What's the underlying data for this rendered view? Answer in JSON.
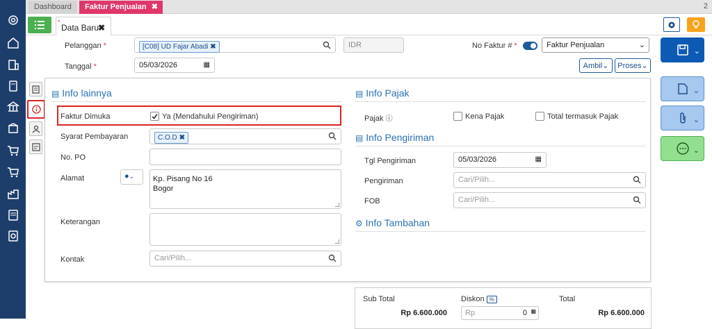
{
  "tabs": {
    "dashboard": "Dashboard",
    "faktur": "Faktur Penjualan",
    "count": "2"
  },
  "toolbar": {
    "data_tab": "Data Baru"
  },
  "header": {
    "pelanggan_label": "Pelanggan",
    "pelanggan_chip": "[C08] UD Fajar Abadi",
    "currency": "IDR",
    "no_faktur_label": "No Faktur #",
    "no_faktur_select": "Faktur Penjualan",
    "tanggal_label": "Tanggal",
    "tanggal_value": "05/03/2026",
    "ambil_label": "Ambil",
    "proses_label": "Proses"
  },
  "info_lainnya": {
    "title": "Info lainnya",
    "faktur_dimuka_label": "Faktur Dimuka",
    "faktur_dimuka_option": "Ya (Mendahului Pengiriman)",
    "syarat_label": "Syarat Pembayaran",
    "syarat_chip": "C.O.D",
    "po_label": "No. PO",
    "alamat_label": "Alamat",
    "alamat_line1": "Kp. Pisang No 16",
    "alamat_line2": "Bogor",
    "keterangan_label": "Keterangan",
    "kontak_label": "Kontak",
    "kontak_placeholder": "Cari/Pilih..."
  },
  "info_pajak": {
    "title": "Info Pajak",
    "pajak_label": "Pajak",
    "kena_pajak": "Kena Pajak",
    "total_pajak": "Total termasuk Pajak"
  },
  "info_pengiriman": {
    "title": "Info Pengiriman",
    "tgl_label": "Tgl Pengiriman",
    "tgl_value": "05/03/2026",
    "pengiriman_label": "Pengiriman",
    "pengiriman_placeholder": "Cari/Pilih...",
    "fob_label": "FOB",
    "fob_placeholder": "Cari/Pilih..."
  },
  "info_tambahan": {
    "title": "Info Tambahan"
  },
  "totals": {
    "subtotal_label": "Sub Total",
    "subtotal_value": "Rp 6.600.000",
    "diskon_label": "Diskon",
    "diskon_percent": "%",
    "diskon_prefix": "Rp",
    "diskon_value": "0",
    "total_label": "Total",
    "total_value": "Rp 6.600.000"
  },
  "colors": {
    "sidebar": "#1d3e6b",
    "accent_tab": "#e0376b",
    "save_button": "#0d5ab4",
    "highlight": "#dd2222"
  }
}
